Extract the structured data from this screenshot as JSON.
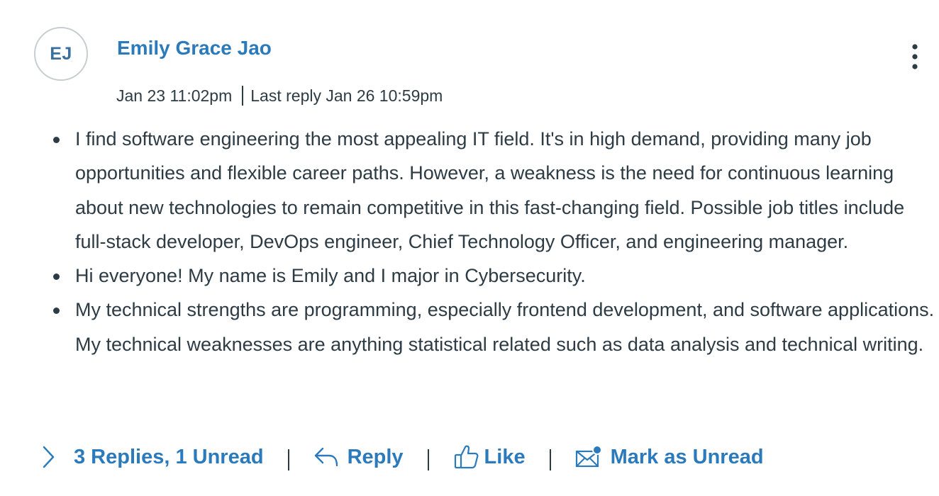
{
  "post": {
    "avatar_initials": "EJ",
    "author_name": "Emily Grace Jao",
    "posted_at": "Jan 23 11:02pm",
    "last_reply": "Last reply Jan 26 10:59pm",
    "bullets": [
      "I find software engineering the most appealing IT field. It's in high demand, providing many job opportunities and flexible career paths. However, a weakness is the need for continuous learning about new technologies to remain competitive in this fast-changing field. Possible job titles include full-stack developer, DevOps engineer, Chief Technology Officer, and engineering manager.",
      "Hi everyone! My name is Emily and I major in Cybersecurity.",
      "My technical strengths are programming, especially frontend development, and software applications. My technical weaknesses are anything statistical related such as data analysis and technical writing."
    ]
  },
  "actions": {
    "replies_label": "3 Replies, 1 Unread",
    "reply_label": "Reply",
    "like_label": "Like",
    "mark_unread_label": "Mark as Unread"
  },
  "icons": {
    "expand": "chevron-right-icon",
    "reply": "reply-arrow-icon",
    "like": "thumbs-up-icon",
    "mark_unread": "envelope-unread-icon",
    "more": "kebab-menu-icon"
  },
  "colors": {
    "link_blue": "#2b7abc",
    "text_dark": "#2d3b45",
    "avatar_border": "#c7cdd1"
  }
}
